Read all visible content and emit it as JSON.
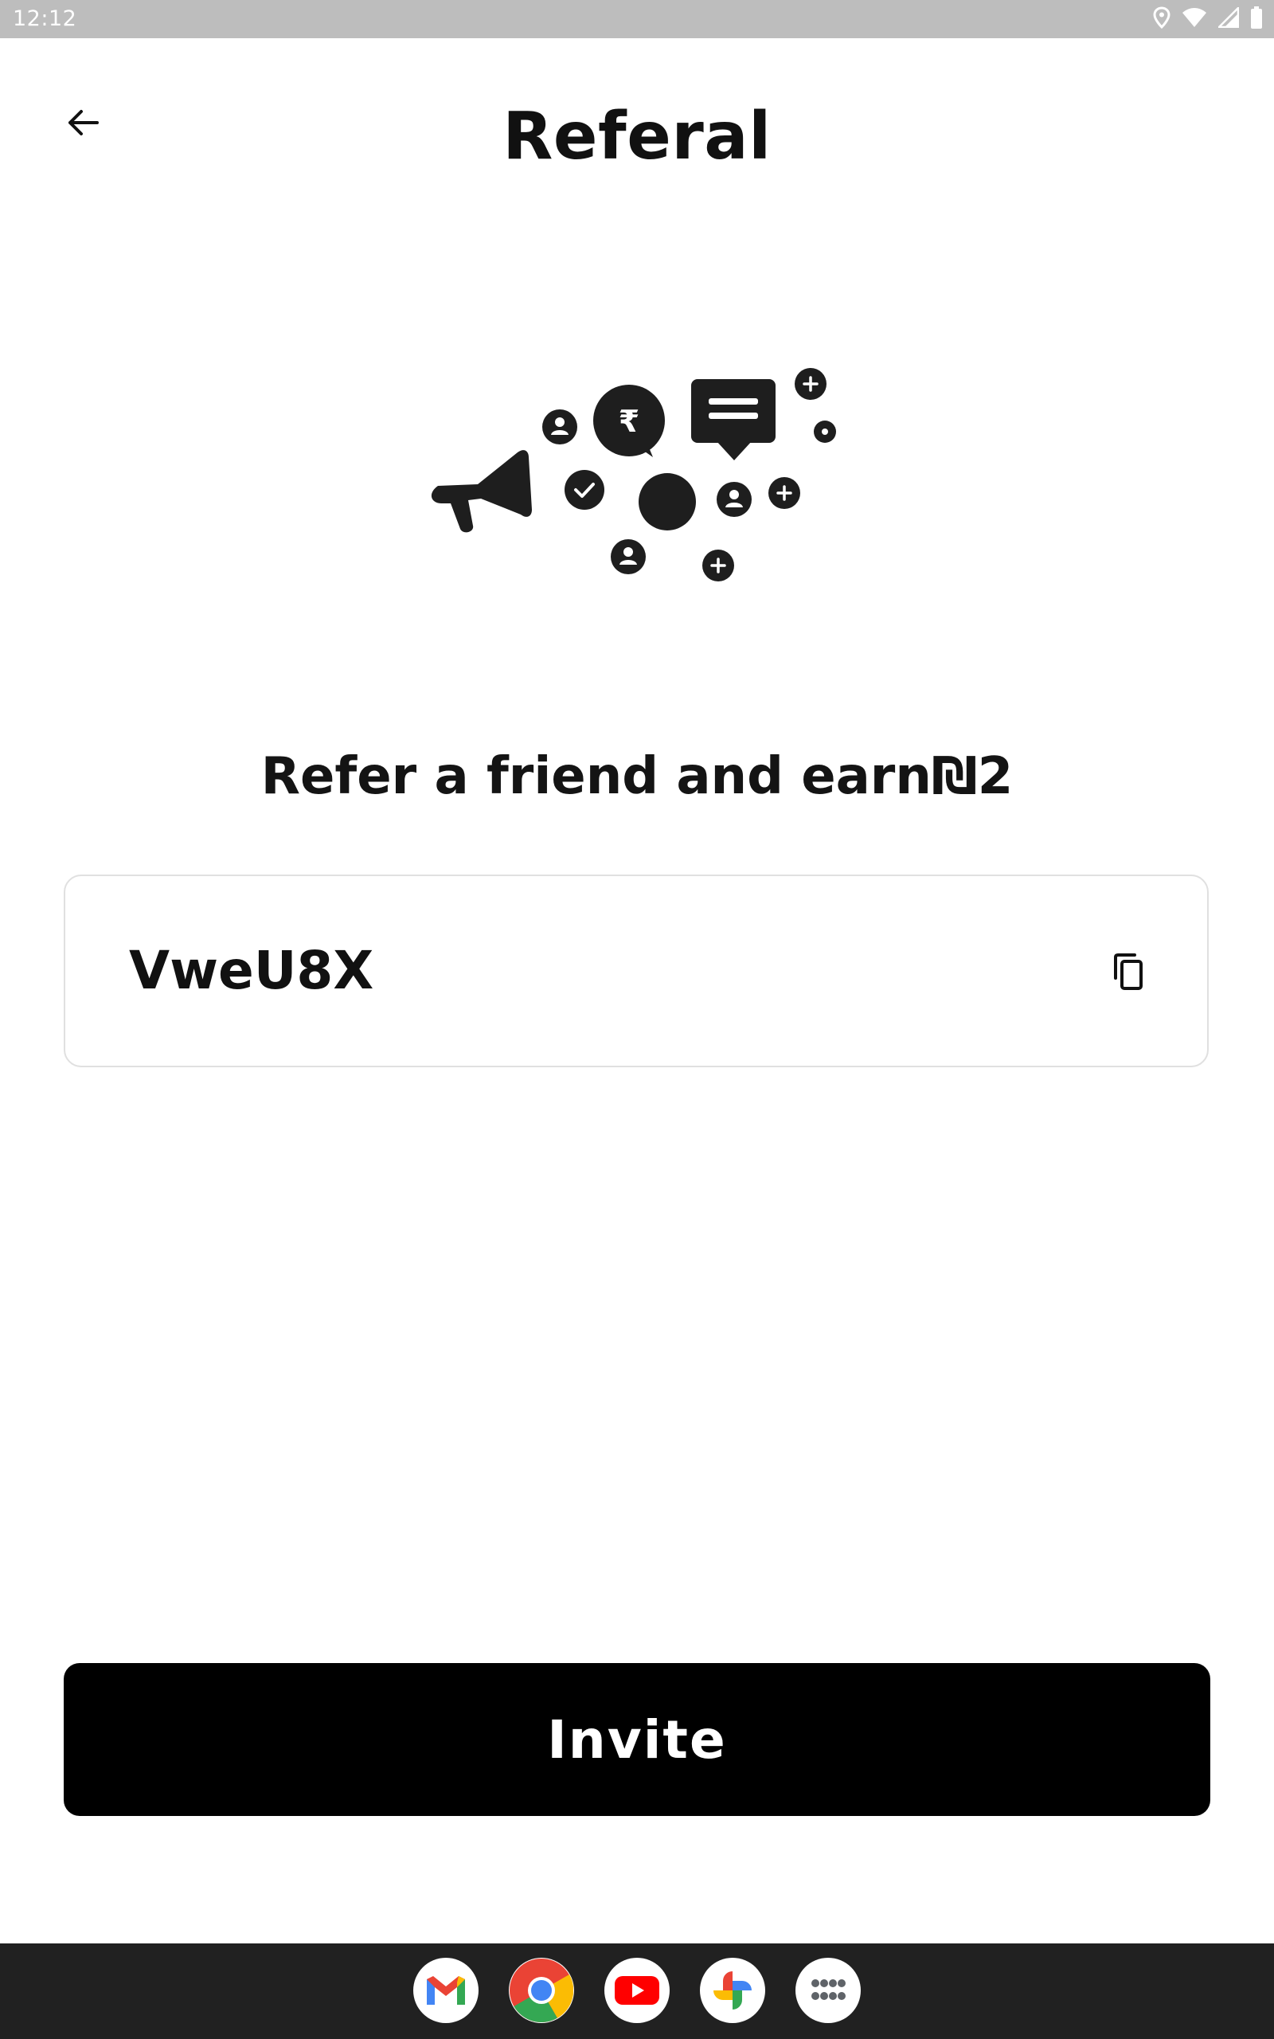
{
  "status_bar": {
    "time": "12:12",
    "icons": [
      "location-icon",
      "wifi-icon",
      "signal-icon",
      "battery-icon"
    ]
  },
  "header": {
    "back_icon": "arrow-left-icon",
    "title": "Referal"
  },
  "illustration": {
    "icon": "referral-megaphone-illustration"
  },
  "main": {
    "subtitle": "Refer a friend and earn₪2",
    "referral_code": "VweU8X",
    "copy_icon": "copy-icon",
    "invite_label": "Invite"
  },
  "dock": {
    "apps": [
      "Gmail",
      "Chrome",
      "YouTube",
      "Photos",
      "App drawer"
    ]
  },
  "colors": {
    "status_bar_bg": "#bdbdbd",
    "primary_button": "#000000",
    "card_border": "#e0e0e0",
    "dock_bg": "#212121"
  }
}
